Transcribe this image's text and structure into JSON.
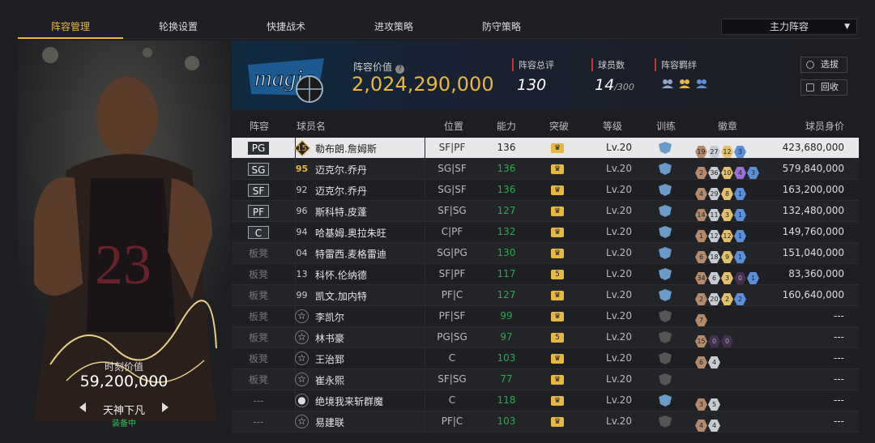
{
  "tabs": [
    "阵容管理",
    "轮换设置",
    "快捷战术",
    "进攻策略",
    "防守策略"
  ],
  "lineup_select": "主力阵容",
  "card": {
    "value_label": "时刻价值",
    "value": "59,200,000",
    "name": "天神下凡",
    "status": "装备中"
  },
  "header": {
    "value_label": "阵容价值",
    "value": "2,024,290,000",
    "rating_label": "阵容总评",
    "rating": "130",
    "count_label": "球员数",
    "count": "14",
    "count_max": "/300",
    "synergy_label": "阵容羁绊",
    "btn_select": "选拔",
    "btn_recycle": "回收"
  },
  "columns": [
    "阵容",
    "球员名",
    "位置",
    "能力",
    "突破",
    "等级",
    "训练",
    "徽章",
    "球员身价"
  ],
  "rows": [
    {
      "slot": "PG",
      "ovr": "15",
      "name": "勒布朗.詹姆斯",
      "pos": "SF|PF",
      "ability": "136",
      "level": "Lv.20",
      "badges": [
        [
          "b",
          "19"
        ],
        [
          "s",
          "27"
        ],
        [
          "g",
          "12"
        ],
        [
          "d",
          "3"
        ]
      ],
      "money": "423,680,000"
    },
    {
      "slot": "SG",
      "ovr": "95",
      "name": "迈克尔.乔丹",
      "pos": "SG|SF",
      "ability": "136",
      "level": "Lv.20",
      "badges": [
        [
          "b",
          "2"
        ],
        [
          "s",
          "36"
        ],
        [
          "g",
          "10"
        ],
        [
          "p",
          "4"
        ],
        [
          "d",
          "3"
        ]
      ],
      "money": "579,840,000"
    },
    {
      "slot": "SF",
      "ovr": "92",
      "name": "迈克尔.乔丹",
      "pos": "SG|SF",
      "ability": "136",
      "level": "Lv.20",
      "badges": [
        [
          "b",
          "4"
        ],
        [
          "s",
          "29"
        ],
        [
          "g",
          "8"
        ],
        [
          "d",
          "1"
        ]
      ],
      "money": "163,200,000"
    },
    {
      "slot": "PF",
      "ovr": "96",
      "name": "斯科特.皮蓬",
      "pos": "SF|SG",
      "ability": "127",
      "level": "Lv.20",
      "badges": [
        [
          "b",
          "14"
        ],
        [
          "s",
          "11"
        ],
        [
          "g",
          "3"
        ],
        [
          "d",
          "1"
        ]
      ],
      "money": "132,480,000"
    },
    {
      "slot": "C",
      "ovr": "94",
      "name": "哈基姆.奥拉朱旺",
      "pos": "C|PF",
      "ability": "132",
      "level": "Lv.20",
      "badges": [
        [
          "b",
          "1"
        ],
        [
          "s",
          "12"
        ],
        [
          "g",
          "12"
        ],
        [
          "d",
          "1"
        ]
      ],
      "money": "149,760,000"
    },
    {
      "slot": "板凳",
      "ovr": "04",
      "name": "特雷西.麦格雷迪",
      "pos": "SG|PG",
      "ability": "130",
      "level": "Lv.20",
      "badges": [
        [
          "b",
          "6"
        ],
        [
          "s",
          "18"
        ],
        [
          "g",
          "9"
        ],
        [
          "d",
          "1"
        ]
      ],
      "money": "151,040,000"
    },
    {
      "slot": "板凳",
      "ovr": "13",
      "name": "科怀.伦纳德",
      "pos": "SF|PF",
      "ability": "117",
      "level": "Lv.20",
      "breach": "5",
      "badges": [
        [
          "b",
          "34"
        ],
        [
          "s",
          "6"
        ],
        [
          "g",
          "3"
        ],
        [
          "x",
          "0"
        ],
        [
          "d",
          "1"
        ]
      ],
      "money": "83,360,000"
    },
    {
      "slot": "板凳",
      "ovr": "99",
      "name": "凯文.加内特",
      "pos": "PF|C",
      "ability": "127",
      "level": "Lv.20",
      "badges": [
        [
          "b",
          "2"
        ],
        [
          "s",
          "20"
        ],
        [
          "g",
          "2"
        ],
        [
          "d",
          "2"
        ]
      ],
      "money": "160,640,000"
    },
    {
      "slot": "板凳",
      "ovr": "☆",
      "name": "李凯尔",
      "pos": "PF|SF",
      "ability": "99",
      "level": "Lv.20",
      "badges": [
        [
          "b",
          "7"
        ]
      ],
      "money": "---"
    },
    {
      "slot": "板凳",
      "ovr": "☆",
      "name": "林书豪",
      "pos": "PG|SG",
      "ability": "97",
      "level": "Lv.20",
      "breach": "5",
      "badges": [
        [
          "b",
          "15"
        ],
        [
          "x",
          "0"
        ],
        [
          "x",
          "0"
        ]
      ],
      "money": "---"
    },
    {
      "slot": "板凳",
      "ovr": "☆",
      "name": "王治郅",
      "pos": "C",
      "ability": "103",
      "level": "Lv.20",
      "badges": [
        [
          "b",
          "6"
        ],
        [
          "s",
          "4"
        ]
      ],
      "money": "---"
    },
    {
      "slot": "板凳",
      "ovr": "☆",
      "name": "崔永熙",
      "pos": "SF|SG",
      "ability": "77",
      "level": "Lv.20",
      "badges": [],
      "money": "---"
    },
    {
      "slot": "---",
      "ovr": "●",
      "name": "绝境我来斩群魔",
      "pos": "C",
      "ability": "118",
      "level": "Lv.20",
      "badges": [
        [
          "b",
          "3"
        ],
        [
          "s",
          "5"
        ]
      ],
      "money": "---"
    },
    {
      "slot": "---",
      "ovr": "☆",
      "name": "易建联",
      "pos": "PF|C",
      "ability": "103",
      "level": "Lv.20",
      "badges": [
        [
          "b",
          "4"
        ],
        [
          "s",
          "4"
        ]
      ],
      "money": "---"
    }
  ]
}
